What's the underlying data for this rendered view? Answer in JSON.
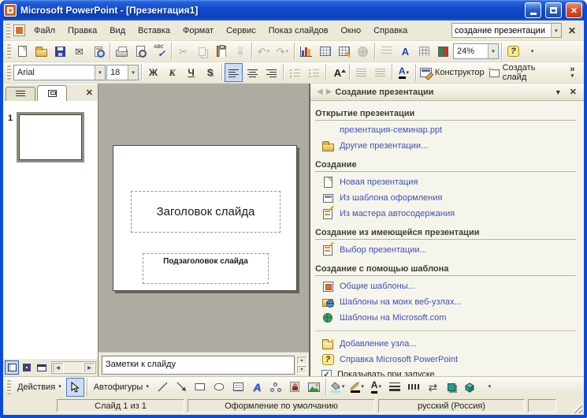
{
  "window": {
    "title": "Microsoft PowerPoint - [Презентация1]"
  },
  "menu": {
    "items": [
      "Файл",
      "Правка",
      "Вид",
      "Вставка",
      "Формат",
      "Сервис",
      "Показ слайдов",
      "Окно",
      "Справка"
    ],
    "question_value": "создание презентации"
  },
  "standard_toolbar": {
    "zoom_value": "24%"
  },
  "formatting": {
    "font": "Arial",
    "size": "18",
    "bold": "Ж",
    "italic": "К",
    "underline": "Ч",
    "shadow": "S",
    "design": "Конструктор",
    "new_slide": "Создать слайд"
  },
  "slides_panel": {
    "slide_number": "1"
  },
  "slide": {
    "title": "Заголовок слайда",
    "subtitle": "Подзаголовок слайда"
  },
  "notes": {
    "text": "Заметки к слайду"
  },
  "task_pane": {
    "title": "Создание презентации",
    "sections": [
      {
        "header": "Открытие презентации",
        "items": [
          {
            "label": "презентация-семинар.ppt"
          },
          {
            "label": "Другие презентации..."
          }
        ]
      },
      {
        "header": "Создание",
        "items": [
          {
            "label": "Новая презентация"
          },
          {
            "label": "Из шаблона оформления"
          },
          {
            "label": "Из мастера автосодержания"
          }
        ]
      },
      {
        "header": "Создание из имеющейся презентации",
        "items": [
          {
            "label": "Выбор презентации..."
          }
        ]
      },
      {
        "header": "Создание с помощью шаблона",
        "items": [
          {
            "label": "Общие шаблоны..."
          },
          {
            "label": "Шаблоны на моих веб-узлах..."
          },
          {
            "label": "Шаблоны на Microsoft.com"
          }
        ]
      }
    ],
    "footer": {
      "links": [
        "Добавление узла...",
        "Справка Microsoft PowerPoint"
      ],
      "checkbox_label": "Показывать при запуске",
      "checkbox_checked": true
    }
  },
  "drawing": {
    "draw": "Действия",
    "autoshapes": "Автофигуры"
  },
  "status": {
    "cells": [
      "Слайд 1 из 1",
      "Оформление по умолчанию",
      "русский (Россия)"
    ]
  },
  "glyphs": {
    "caret": "▾",
    "caret_down": "▼",
    "close": "✕",
    "question": "?",
    "chevron": "»",
    "back": "◀",
    "forward": "▶",
    "up": "▲",
    "down": "▼",
    "left": "◀",
    "right": "▶",
    "scissors": "✂",
    "undo": "↶",
    "redo": "↷",
    "envelope": "✉",
    "letter_a": "A",
    "letter_a_cyr": "А",
    "arrows_lr": "⇄",
    "abc": "ABC",
    "check": "✓"
  }
}
